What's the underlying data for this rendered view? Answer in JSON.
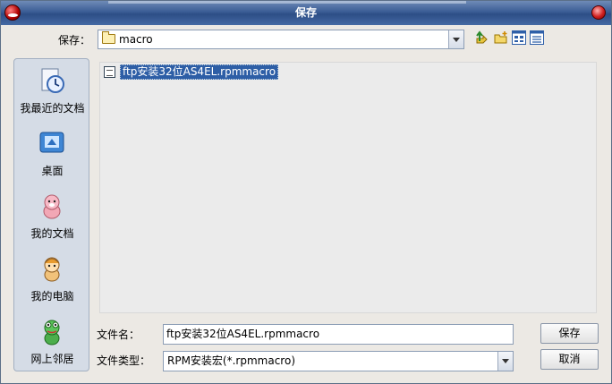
{
  "window": {
    "title": "保存"
  },
  "save_in": {
    "label": "保存：",
    "value": "macro"
  },
  "toolbar": {
    "icons": [
      "up-folder-icon",
      "new-folder-icon",
      "list-view-icon",
      "details-view-icon"
    ]
  },
  "places": [
    {
      "label": "我最近的文档",
      "icon": "recent-documents-icon"
    },
    {
      "label": "桌面",
      "icon": "desktop-icon"
    },
    {
      "label": "我的文档",
      "icon": "my-documents-icon"
    },
    {
      "label": "我的电脑",
      "icon": "my-computer-icon"
    },
    {
      "label": "网上邻居",
      "icon": "network-icon"
    }
  ],
  "files": [
    {
      "name": "ftp安装32位AS4EL.rpmmacro",
      "selected": true
    }
  ],
  "filename": {
    "label": "文件名：",
    "value": "ftp安装32位AS4EL.rpmmacro"
  },
  "filetype": {
    "label": "文件类型：",
    "value": "RPM安装宏(*.rpmmacro)"
  },
  "buttons": {
    "save": "保存",
    "cancel": "取消"
  },
  "colors": {
    "titlebar": "#3b5d95",
    "selection": "#2d5ea6",
    "places_bg": "#d5dce6"
  }
}
